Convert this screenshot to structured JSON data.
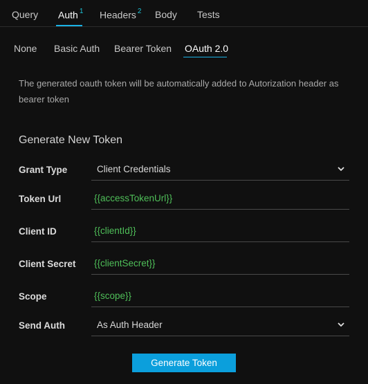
{
  "top_tabs": [
    {
      "label": "Query",
      "badge": ""
    },
    {
      "label": "Auth",
      "badge": "1"
    },
    {
      "label": "Headers",
      "badge": "2"
    },
    {
      "label": "Body",
      "badge": ""
    },
    {
      "label": "Tests",
      "badge": ""
    }
  ],
  "auth_tabs": [
    "None",
    "Basic Auth",
    "Bearer Token",
    "OAuth 2.0"
  ],
  "info_text": "The generated oauth token will be automatically added to Autorization header as bearer token",
  "section_title": "Generate New Token",
  "form": {
    "grant_type": {
      "label": "Grant Type",
      "value": "Client Credentials"
    },
    "token_url": {
      "label": "Token Url",
      "value": "{{accessTokenUrl}}"
    },
    "client_id": {
      "label": "Client ID",
      "value": "{{clientId}}"
    },
    "client_secret": {
      "label": "Client Secret",
      "value": "{{clientSecret}}"
    },
    "scope": {
      "label": "Scope",
      "value": "{{scope}}"
    },
    "send_auth": {
      "label": "Send Auth",
      "value": "As Auth Header"
    }
  },
  "generate_button": "Generate Token",
  "colors": {
    "background": "#101010",
    "accent": "#1ab2e6",
    "button": "#0b9fdc",
    "variable_text": "#4fbf59",
    "badge": "#1ec4d8"
  },
  "icons": {
    "select_chevron": "chevron-down-icon"
  }
}
